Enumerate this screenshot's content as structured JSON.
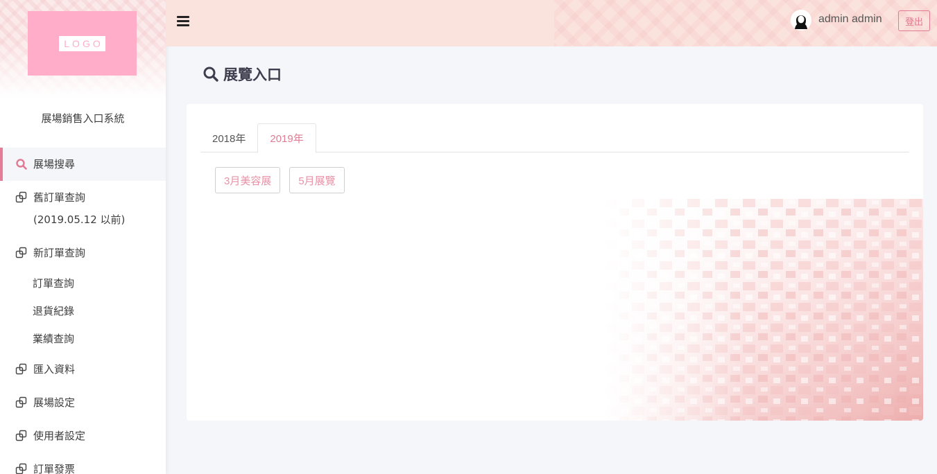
{
  "sidebar": {
    "logo_text": "LOGO",
    "app_title": "展場銷售入口系統",
    "items": [
      {
        "label": "展場搜尋",
        "icon": "search-icon",
        "active": true
      },
      {
        "label": "舊訂單查詢",
        "sublabel": "(2019.05.12 以前)",
        "icon": "clone-icon"
      },
      {
        "label": "新訂單查詢",
        "icon": "clone-icon"
      },
      {
        "label": "匯入資料",
        "icon": "clone-icon"
      },
      {
        "label": "展場設定",
        "icon": "clone-icon"
      },
      {
        "label": "使用者設定",
        "icon": "clone-icon"
      },
      {
        "label": "訂單發票",
        "icon": "clone-icon"
      }
    ],
    "subitems": [
      "訂單查詢",
      "退貨紀錄",
      "業績查詢"
    ]
  },
  "topbar": {
    "menu_icon": "hamburger-icon",
    "avatar_icon": "user-avatar-icon",
    "username": "admin admin",
    "logout_label": "登出"
  },
  "page": {
    "title": "展覽入口",
    "title_icon": "search-icon"
  },
  "tabs": [
    {
      "label": "2018年",
      "active": false
    },
    {
      "label": "2019年",
      "active": true
    }
  ],
  "exhibitions": [
    "3月美容展",
    "5月展覽"
  ],
  "colors": {
    "accent": "#e07b93",
    "logo_bg": "#ffadc9",
    "topbar_bg": "#fbe3dd",
    "page_bg": "#f5f6fa"
  }
}
